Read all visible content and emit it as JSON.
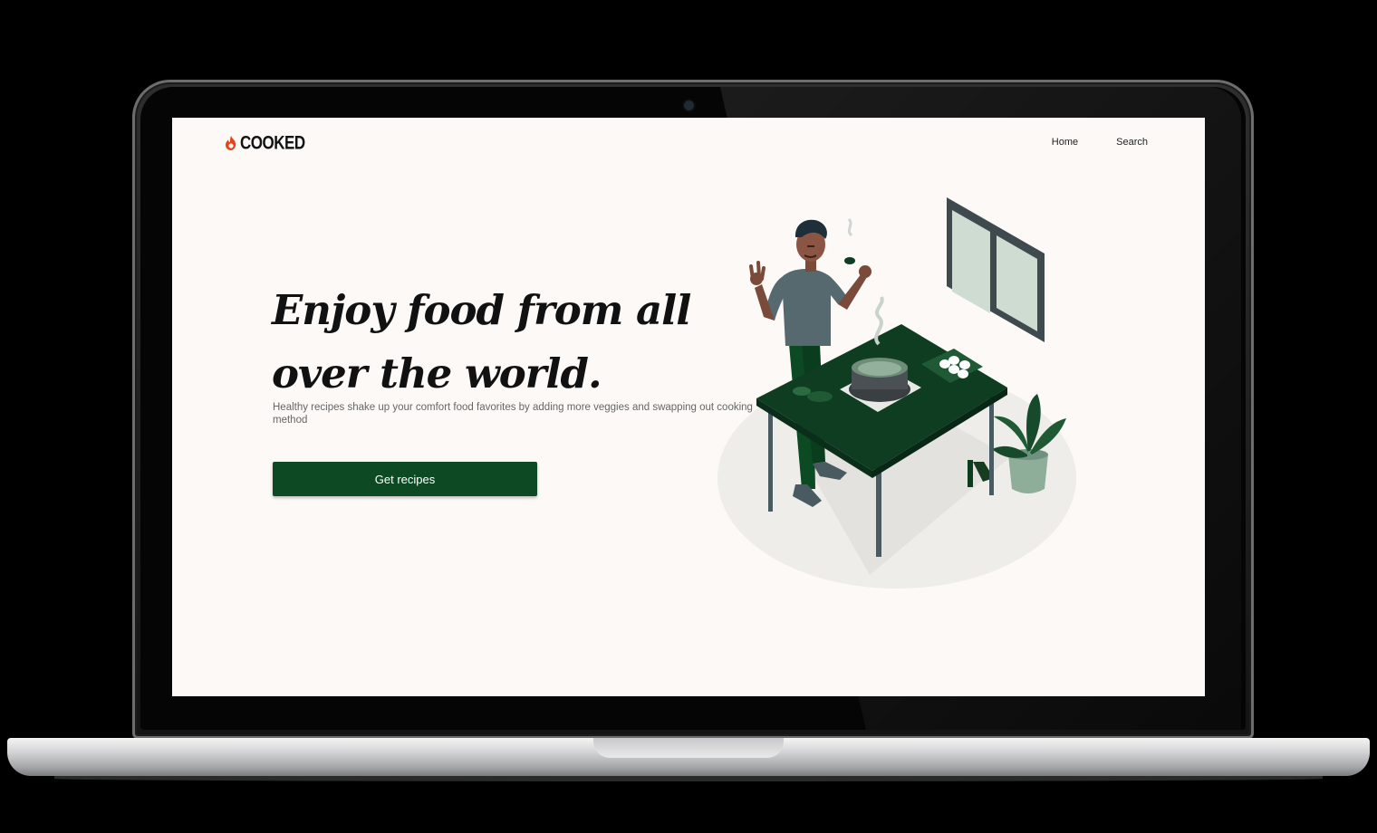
{
  "brand": {
    "name": "COOKED",
    "accent": "#e8421c"
  },
  "nav": {
    "items": [
      {
        "label": "Home"
      },
      {
        "label": "Search"
      }
    ]
  },
  "hero": {
    "title": "Enjoy food from all over the world.",
    "subtitle": "Healthy recipes shake up your comfort food favorites by adding more veggies and swapping out cooking method",
    "cta_label": "Get recipes"
  },
  "colors": {
    "background": "#fcf9f6",
    "primary": "#0d4a24",
    "text": "#111111"
  },
  "illustration": {
    "icon": "chef-cooking-illustration"
  }
}
